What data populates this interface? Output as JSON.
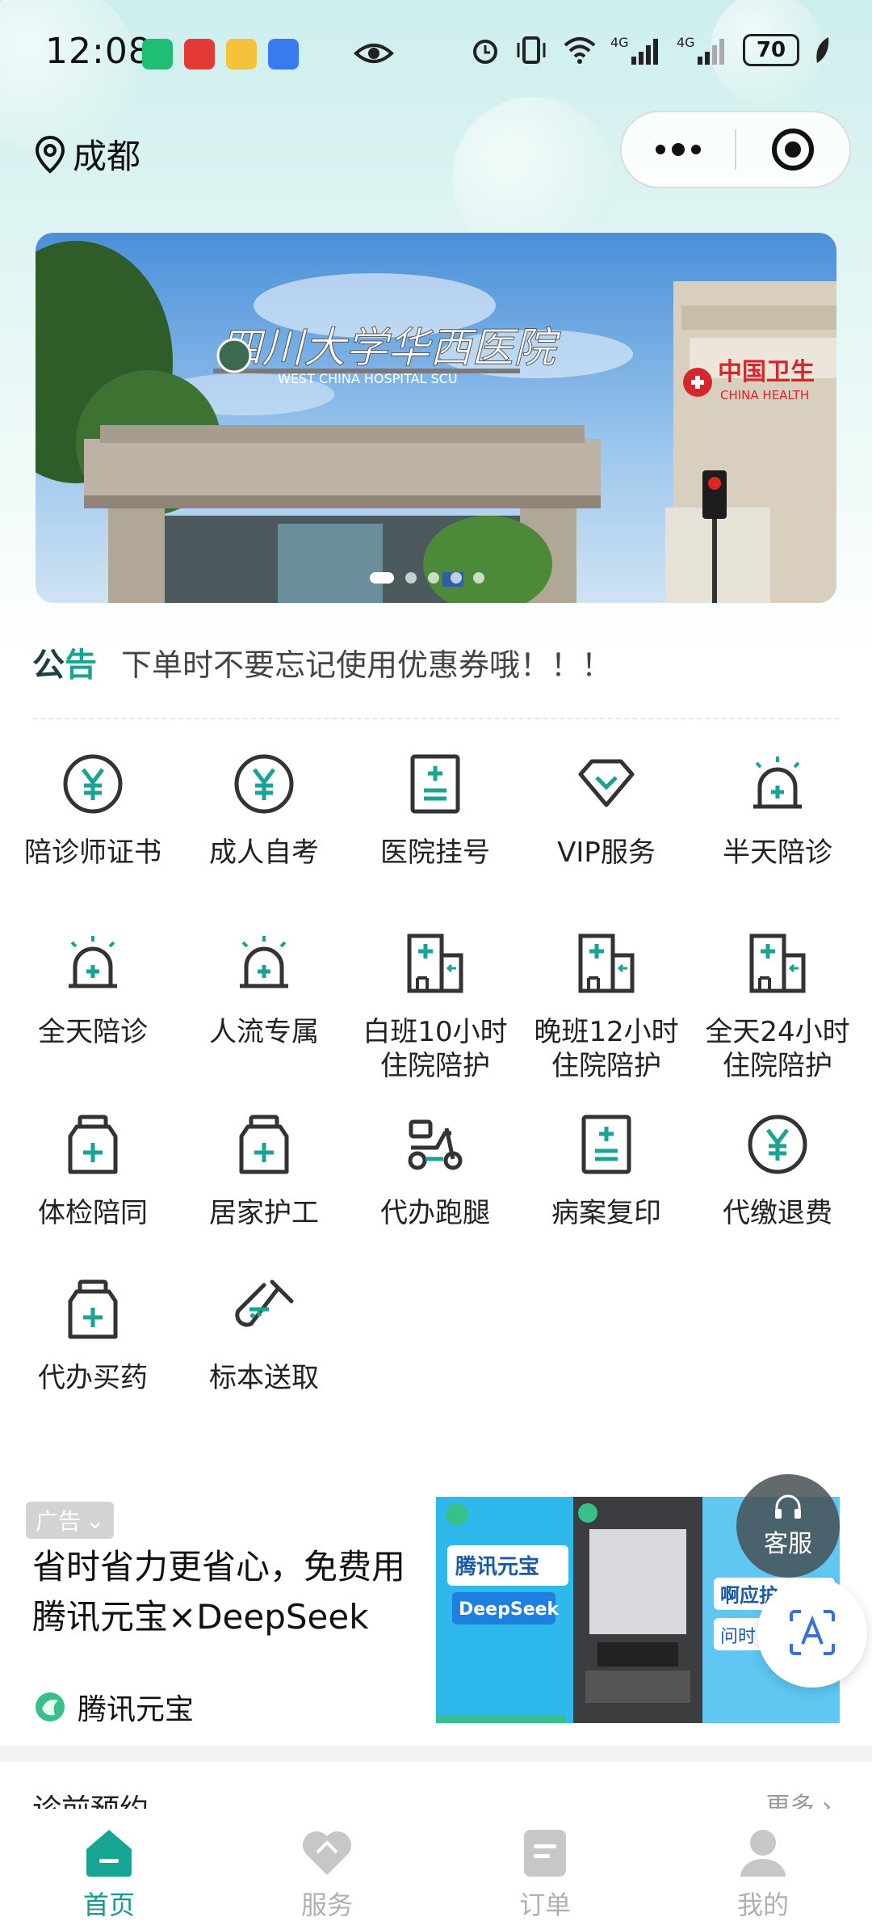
{
  "status_bar": {
    "time": "12:08",
    "battery": "70",
    "icons": [
      "hourglass-icon",
      "huawei-app-icon",
      "weibo-icon",
      "security-app-icon",
      "eye-icon",
      "alarm-icon",
      "vibrate-icon",
      "wifi-icon",
      "4g-signal-icon",
      "4g-signal-icon",
      "battery-icon",
      "charging-leaf-icon"
    ]
  },
  "header": {
    "city": "成都",
    "capsule": {
      "more_icon": "more-dots-icon",
      "close_icon": "target-circle-icon"
    }
  },
  "banner": {
    "hospital_sign": "WEST CHINA HOSPITAL SCU",
    "side_sign_cn": "中国卫生",
    "side_sign_en": "CHINA HEALTH",
    "slide_count": 5,
    "active_slide": 1
  },
  "notice": {
    "tag_part1": "公",
    "tag_part2": "告",
    "text": "下单时不要忘记使用优惠券哦！！！"
  },
  "services": [
    {
      "label": "陪诊师证书",
      "icon": "yuan-coin-icon"
    },
    {
      "label": "成人自考",
      "icon": "yuan-coin-icon"
    },
    {
      "label": "医院挂号",
      "icon": "medical-record-icon"
    },
    {
      "label": "VIP服务",
      "icon": "diamond-icon"
    },
    {
      "label": "半天陪诊",
      "icon": "medical-alarm-icon"
    },
    {
      "label": "全天陪诊",
      "icon": "medical-alarm-icon"
    },
    {
      "label": "人流专属",
      "icon": "medical-alarm-icon"
    },
    {
      "label": "白班10小时\n住院陪护",
      "icon": "hospital-building-icon"
    },
    {
      "label": "晚班12小时\n住院陪护",
      "icon": "hospital-building-icon"
    },
    {
      "label": "全天24小时\n住院陪护",
      "icon": "hospital-building-icon"
    },
    {
      "label": "体检陪同",
      "icon": "medicine-bottle-icon"
    },
    {
      "label": "居家护工",
      "icon": "medicine-bottle-icon"
    },
    {
      "label": "代办跑腿",
      "icon": "scooter-icon"
    },
    {
      "label": "病案复印",
      "icon": "medical-record-icon"
    },
    {
      "label": "代缴退费",
      "icon": "yuan-coin-icon"
    },
    {
      "label": "代办买药",
      "icon": "medicine-bottle-icon"
    },
    {
      "label": "标本送取",
      "icon": "test-tube-icon"
    }
  ],
  "ad": {
    "tag": "广告",
    "title": "省时省力更省心，免费用腾讯元宝×DeepSeek",
    "brand": "腾讯元宝",
    "panel1_title": "腾讯元宝",
    "panel1_sub": "DeepSeek",
    "panel3_title": "啊应护",
    "panel3_sub": "问时"
  },
  "floating": {
    "service_label": "客服",
    "service_icon": "headset-icon",
    "scan_icon": "text-recognition-icon"
  },
  "next_section": {
    "title": "诊前预约",
    "more": "更多 ›"
  },
  "tabbar": [
    {
      "label": "首页",
      "icon": "home-icon",
      "active": true
    },
    {
      "label": "服务",
      "icon": "heart-icon",
      "active": false
    },
    {
      "label": "订单",
      "icon": "order-icon",
      "active": false
    },
    {
      "label": "我的",
      "icon": "user-icon",
      "active": false
    }
  ],
  "colors": {
    "accent": "#1aa393",
    "tab_active": "#159a8c",
    "tab_inactive": "#b0b0b0"
  }
}
